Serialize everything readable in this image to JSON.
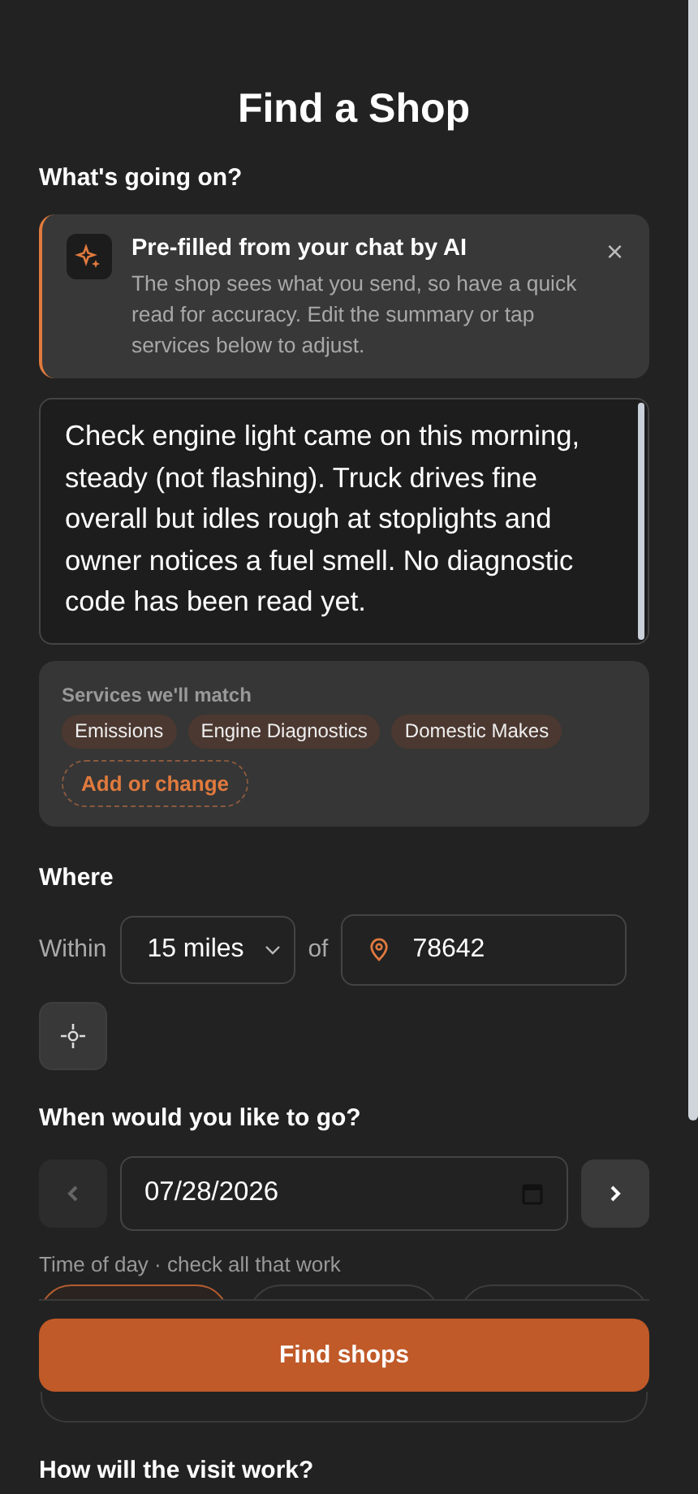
{
  "title": "Find a Shop",
  "issue": {
    "heading": "What's going on?",
    "notice": {
      "title": "Pre-filled from your chat by AI",
      "body": "The shop sees what you send, so have a quick read for accuracy. Edit the summary or tap services below to adjust.",
      "close": "×"
    },
    "summary": "Check engine light came on this morning, steady (not flashing). Truck drives fine overall but idles rough at stoplights and owner notices a fuel smell. No diagnostic code has been read yet.",
    "services": {
      "label": "Services we'll match",
      "tags": [
        "Emissions",
        "Engine Diagnostics",
        "Domestic Makes"
      ],
      "action": "Add or change"
    }
  },
  "where": {
    "heading": "Where",
    "within_label": "Within",
    "radius": "15 miles",
    "of_label": "of",
    "zip": "78642"
  },
  "when": {
    "heading": "When would you like to go?",
    "prev": {
      "disabled": true
    },
    "date": "07/28/2026",
    "next": {
      "disabled": false
    },
    "time_hint": "Time of day · check all that work",
    "time_slots": [
      {
        "selected": true
      },
      {
        "selected": false
      },
      {
        "selected": false
      }
    ]
  },
  "submit": "Find shops",
  "next_heading": "How will the visit work?"
}
